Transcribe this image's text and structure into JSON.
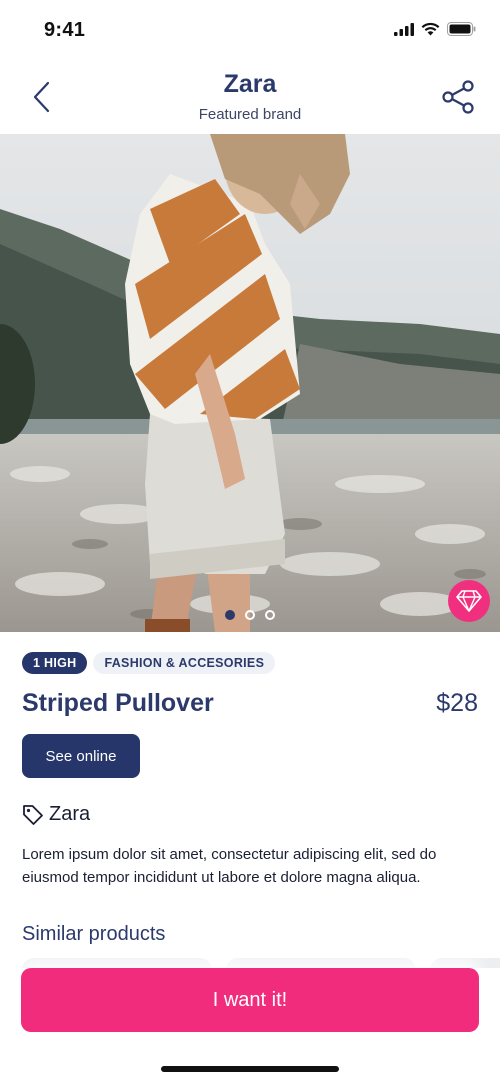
{
  "status_bar": {
    "time": "9:41"
  },
  "header": {
    "title": "Zara",
    "subtitle": "Featured brand",
    "back_icon": "chevron-left-icon",
    "share_icon": "share-icon"
  },
  "hero": {
    "carousel": {
      "count": 3,
      "active_index": 0
    },
    "badge_icon": "diamond-icon"
  },
  "product": {
    "tags": [
      "1 HIGH",
      "FASHION & ACCESORIES"
    ],
    "name": "Striped Pullover",
    "price": "$28",
    "see_online_label": "See online",
    "brand": "Zara",
    "brand_icon": "tag-icon",
    "description": "Lorem ipsum dolor sit amet, consectetur adipiscing elit, sed do eiusmod tempor incididunt ut labore et dolore magna aliqua."
  },
  "similar": {
    "title": "Similar products"
  },
  "cta": {
    "label": "I want it!"
  },
  "colors": {
    "navy": "#26366a",
    "pink": "#f22c7d",
    "text": "#1a1f33"
  }
}
